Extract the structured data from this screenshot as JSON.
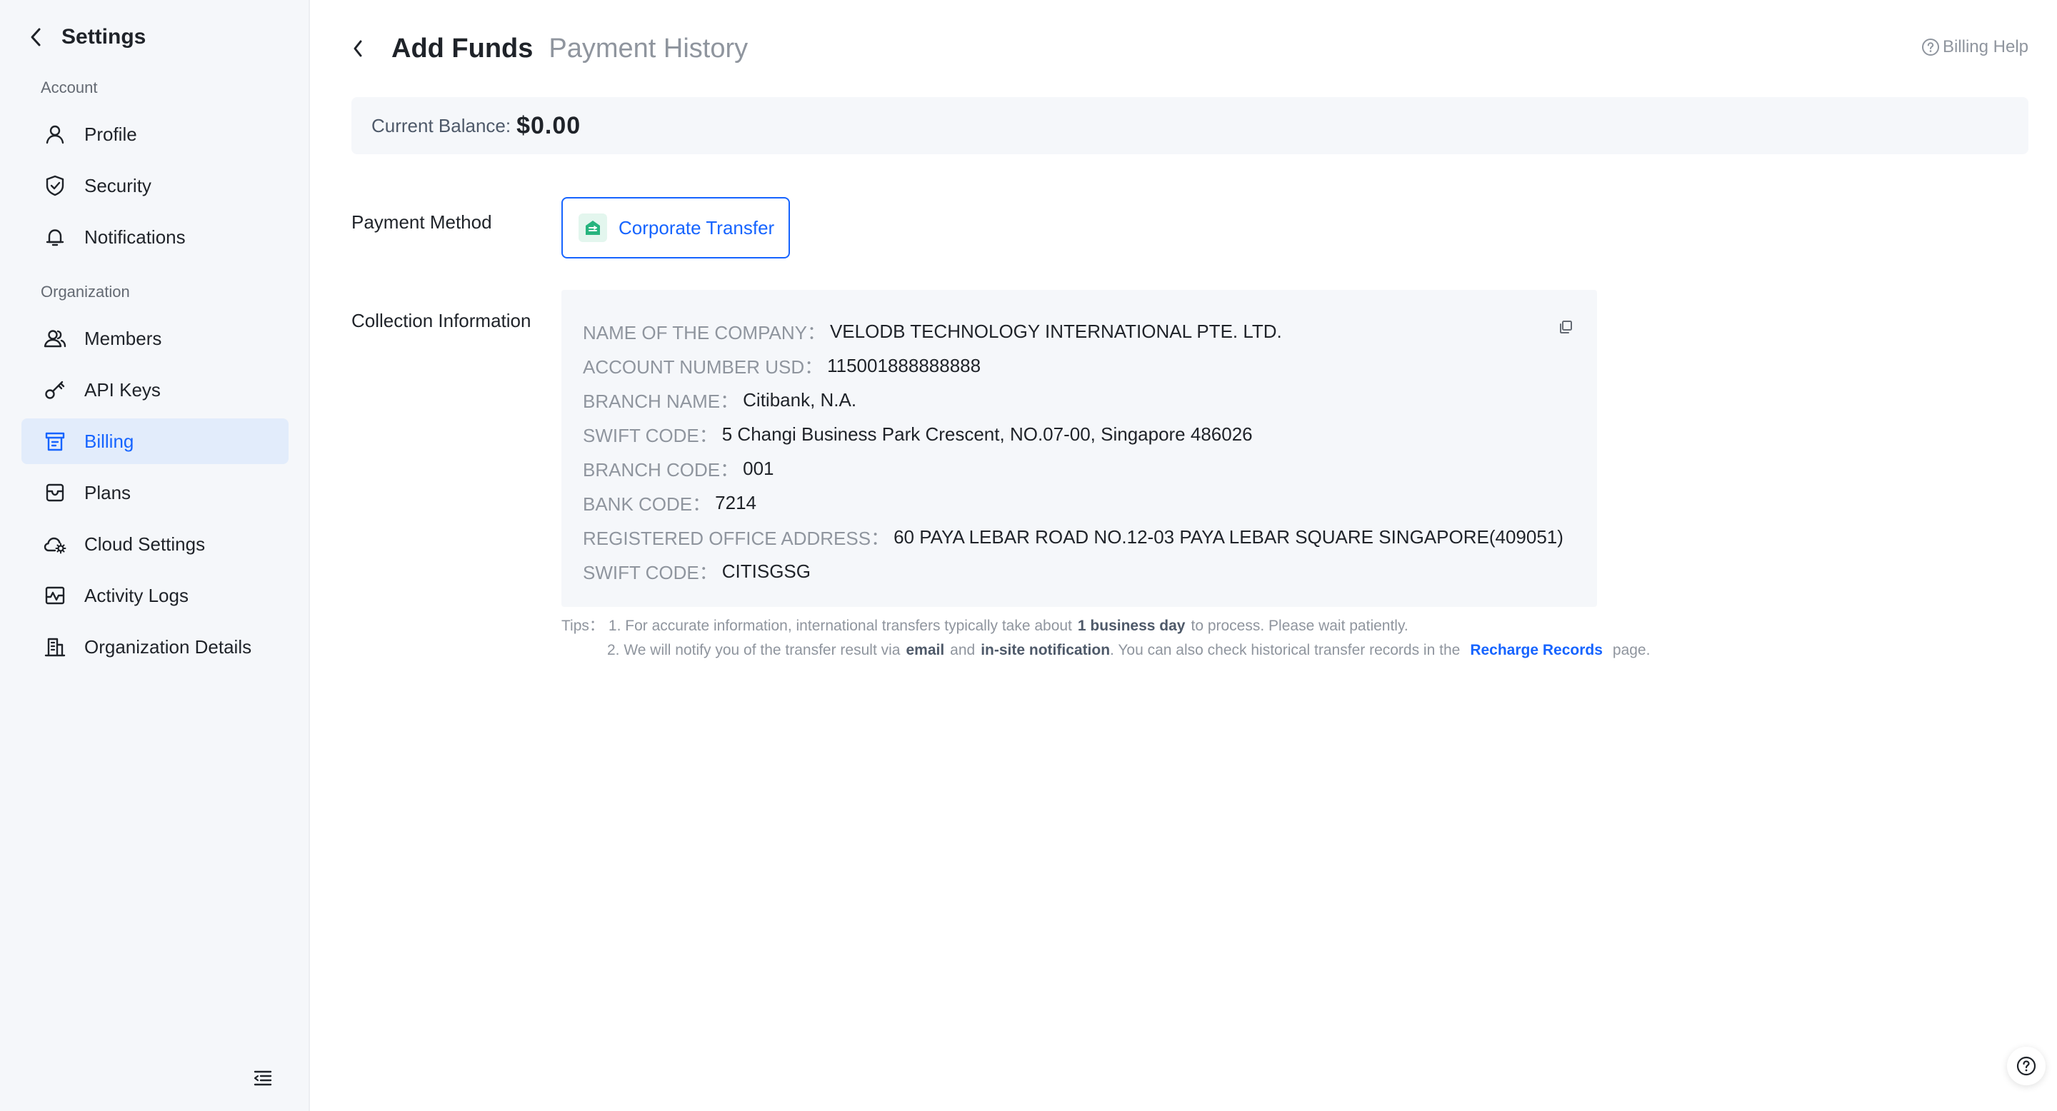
{
  "sidebar": {
    "title": "Settings",
    "groups": {
      "account": "Account",
      "organization": "Organization"
    },
    "items": [
      {
        "label": "Profile",
        "icon": "user-icon"
      },
      {
        "label": "Security",
        "icon": "shield-icon"
      },
      {
        "label": "Notifications",
        "icon": "bell-icon"
      },
      {
        "label": "Members",
        "icon": "users-icon"
      },
      {
        "label": "API Keys",
        "icon": "key-icon"
      },
      {
        "label": "Billing",
        "icon": "billing-icon",
        "active": true
      },
      {
        "label": "Plans",
        "icon": "plans-icon"
      },
      {
        "label": "Cloud Settings",
        "icon": "cloud-gear-icon"
      },
      {
        "label": "Activity Logs",
        "icon": "activity-icon"
      },
      {
        "label": "Organization Details",
        "icon": "building-icon"
      }
    ]
  },
  "header": {
    "tab_active": "Add Funds",
    "tab_inactive": "Payment History",
    "help": "Billing Help"
  },
  "balance": {
    "label": "Current Balance:",
    "value": "$0.00"
  },
  "payment": {
    "label": "Payment Method",
    "method": "Corporate Transfer"
  },
  "collection": {
    "label": "Collection Information",
    "lines": [
      {
        "key": "NAME OF THE COMPANY：",
        "value": "VELODB TECHNOLOGY INTERNATIONAL PTE. LTD."
      },
      {
        "key": "ACCOUNT NUMBER USD：",
        "value": "115001888888888"
      },
      {
        "key": "BRANCH NAME：",
        "value": "Citibank, N.A."
      },
      {
        "key": "SWIFT CODE：",
        "value": "5 Changi Business Park Crescent, NO.07-00, Singapore 486026"
      },
      {
        "key": "BRANCH CODE：",
        "value": "001"
      },
      {
        "key": "BANK CODE：",
        "value": "7214"
      },
      {
        "key": "REGISTERED OFFICE ADDRESS：",
        "value": "60 PAYA LEBAR ROAD NO.12-03 PAYA LEBAR SQUARE SINGAPORE(409051)"
      },
      {
        "key": "SWIFT CODE：",
        "value": "CITISGSG"
      }
    ]
  },
  "tips": {
    "prefix": "Tips：",
    "line1_a": "1. For accurate information, international transfers typically take about",
    "line1_b": "1 business day",
    "line1_c": "to process. Please wait patiently.",
    "line2_a": "2. We will notify you of the transfer result via",
    "line2_b": "email",
    "line2_c": "and",
    "line2_d": "in-site notification",
    "line2_e": ". You can also check historical transfer records in the",
    "line2_link": "Recharge Records",
    "line2_f": "page."
  },
  "colors": {
    "accent": "#1664ff",
    "sidebar_bg": "#f5f7fa",
    "active_bg": "#e2ecfb"
  }
}
